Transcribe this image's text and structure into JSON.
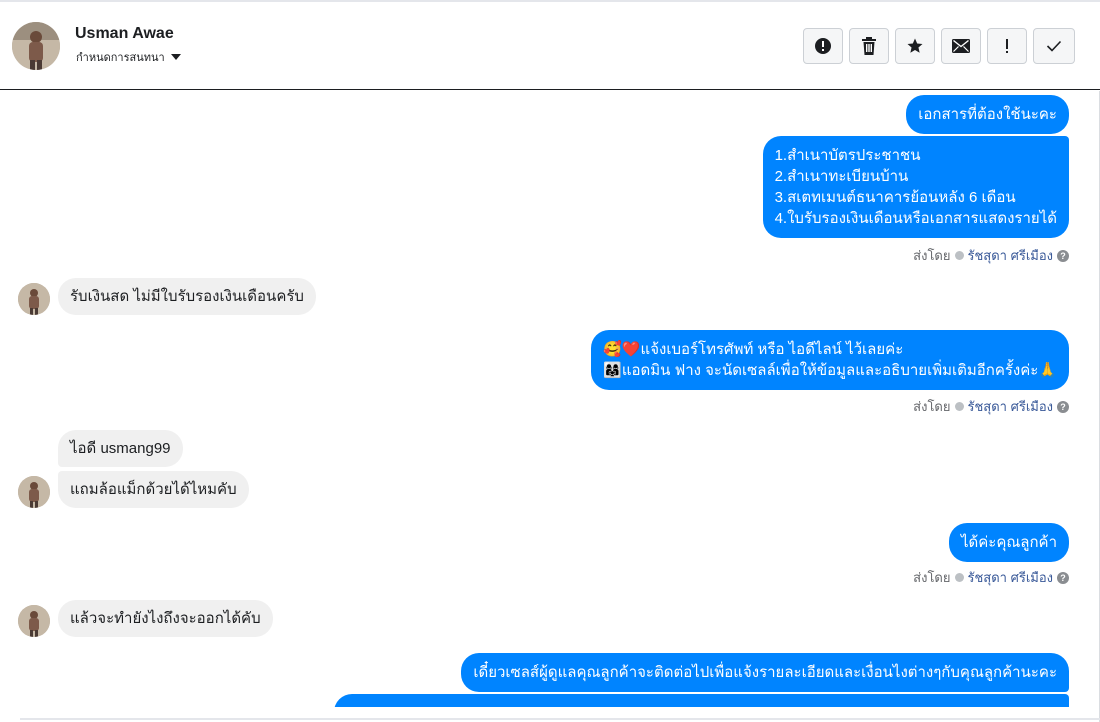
{
  "header": {
    "contact_name": "Usman Awae",
    "assign_label": "กำหนดการสนทนา",
    "actions": [
      {
        "name": "mark-spam-button",
        "icon": "alert-circle-icon"
      },
      {
        "name": "delete-button",
        "icon": "trash-icon"
      },
      {
        "name": "star-button",
        "icon": "star-icon"
      },
      {
        "name": "mark-unread-button",
        "icon": "envelope-icon"
      },
      {
        "name": "follow-up-button",
        "icon": "exclamation-icon"
      },
      {
        "name": "mark-done-button",
        "icon": "checkmark-icon"
      }
    ]
  },
  "colors": {
    "outgoing_bubble": "#0084ff",
    "incoming_bubble": "#f0f0f0",
    "agent_link": "#385898"
  },
  "messages": [
    {
      "id": "m1",
      "dir": "out",
      "text": "เอกสารที่ต้องใช้นะคะ"
    },
    {
      "id": "m2",
      "dir": "out",
      "lines": [
        "1.สำเนาบัตรประชาชน",
        "2.สำเนาทะเบียนบ้าน",
        "3.สเตทเมนต์ธนาคารย้อนหลัง 6 เดือน",
        "4.ใบรับรองเงินเดือนหรือเอกสารแสดงรายได้"
      ]
    },
    {
      "id": "m3",
      "dir": "in",
      "text": "รับเงินสด ไม่มีใบรับรองเงินเดือนครับ"
    },
    {
      "id": "m4",
      "dir": "out",
      "lines": [
        "🥰❤️แจ้งเบอร์โทรศัพท์ หรือ ไอดีไลน์  ไว้เลยค่ะ",
        "👩‍👩‍👧แอดมิน ฟาง จะนัดเซลล์เพื่อให้ข้อมูลและอธิบายเพิ่มเติมอีกครั้งค่ะ🙏"
      ]
    },
    {
      "id": "m5",
      "dir": "in",
      "text": "ไอดี usmang99"
    },
    {
      "id": "m6",
      "dir": "in",
      "text": "แถมล้อแม็กด้วยได้ไหมคับ"
    },
    {
      "id": "m7",
      "dir": "out",
      "text": "ได้ค่ะคุณลูกค้า"
    },
    {
      "id": "m8",
      "dir": "in",
      "text": "แล้วจะทำยังไงถึงจะออกได้คับ"
    },
    {
      "id": "m9",
      "dir": "out",
      "text": "เดี๋ยวเซลส์ผู้ดูแลคุณลูกค้าจะติดต่อไปเพื่อแจ้งรายละเอียดและเงื่อนไงต่างๆกับคุณลูกค้านะคะ"
    }
  ],
  "sent_by": {
    "prefix": "ส่งโดย",
    "agent": "รัชสุดา ศรีเมือง"
  }
}
